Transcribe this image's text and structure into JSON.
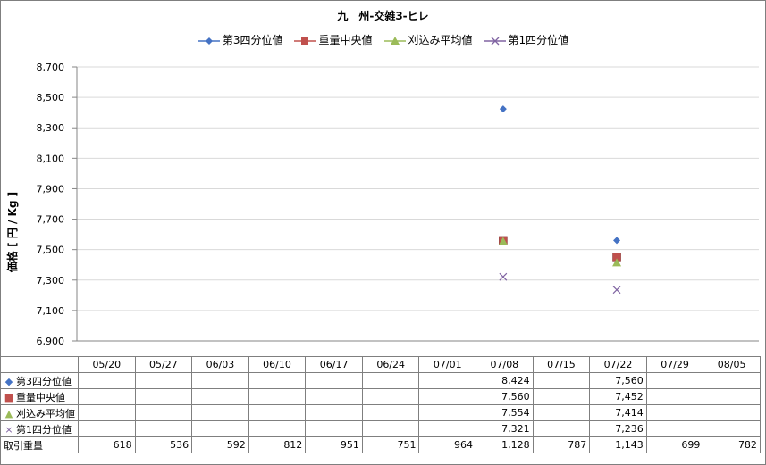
{
  "chart_data": {
    "type": "scatter",
    "title": "九　州-交雑3-ヒレ",
    "ylabel": "価格 [ 円 / Kg ]",
    "xlabel": "",
    "ylim": [
      6900,
      8700
    ],
    "yticks": [
      "6,900",
      "7,100",
      "7,300",
      "7,500",
      "7,700",
      "7,900",
      "8,100",
      "8,300",
      "8,500",
      "8,700"
    ],
    "categories": [
      "05/20",
      "05/27",
      "06/03",
      "06/10",
      "06/17",
      "06/24",
      "07/01",
      "07/08",
      "07/15",
      "07/22",
      "07/29",
      "08/05"
    ],
    "series": [
      {
        "name": "第3四分位値",
        "marker": "diamond",
        "color": "#4472C4",
        "values": [
          null,
          null,
          null,
          null,
          null,
          null,
          null,
          8424,
          null,
          7560,
          null,
          null
        ]
      },
      {
        "name": "重量中央値",
        "marker": "square",
        "color": "#C0504D",
        "values": [
          null,
          null,
          null,
          null,
          null,
          null,
          null,
          7560,
          null,
          7452,
          null,
          null
        ]
      },
      {
        "name": "刈込み平均値",
        "marker": "triangle",
        "color": "#9BBB59",
        "values": [
          null,
          null,
          null,
          null,
          null,
          null,
          null,
          7554,
          null,
          7414,
          null,
          null
        ]
      },
      {
        "name": "第1四分位値",
        "marker": "x",
        "color": "#8064A2",
        "values": [
          null,
          null,
          null,
          null,
          null,
          null,
          null,
          7321,
          null,
          7236,
          null,
          null
        ]
      }
    ],
    "grid": true,
    "legend": "top"
  },
  "table": {
    "rows": [
      {
        "label": "第3四分位値",
        "marker": "◆",
        "color": "#4472C4",
        "cells": [
          "",
          "",
          "",
          "",
          "",
          "",
          "",
          "8,424",
          "",
          "7,560",
          "",
          ""
        ]
      },
      {
        "label": "重量中央値",
        "marker": "■",
        "color": "#C0504D",
        "cells": [
          "",
          "",
          "",
          "",
          "",
          "",
          "",
          "7,560",
          "",
          "7,452",
          "",
          ""
        ]
      },
      {
        "label": "刈込み平均値",
        "marker": "▲",
        "color": "#9BBB59",
        "cells": [
          "",
          "",
          "",
          "",
          "",
          "",
          "",
          "7,554",
          "",
          "7,414",
          "",
          ""
        ]
      },
      {
        "label": "第1四分位値",
        "marker": "×",
        "color": "#8064A2",
        "cells": [
          "",
          "",
          "",
          "",
          "",
          "",
          "",
          "7,321",
          "",
          "7,236",
          "",
          ""
        ]
      },
      {
        "label": "取引重量",
        "marker": "",
        "color": "#000000",
        "cells": [
          "618",
          "536",
          "592",
          "812",
          "951",
          "751",
          "964",
          "1,128",
          "787",
          "1,143",
          "699",
          "782"
        ]
      }
    ]
  }
}
